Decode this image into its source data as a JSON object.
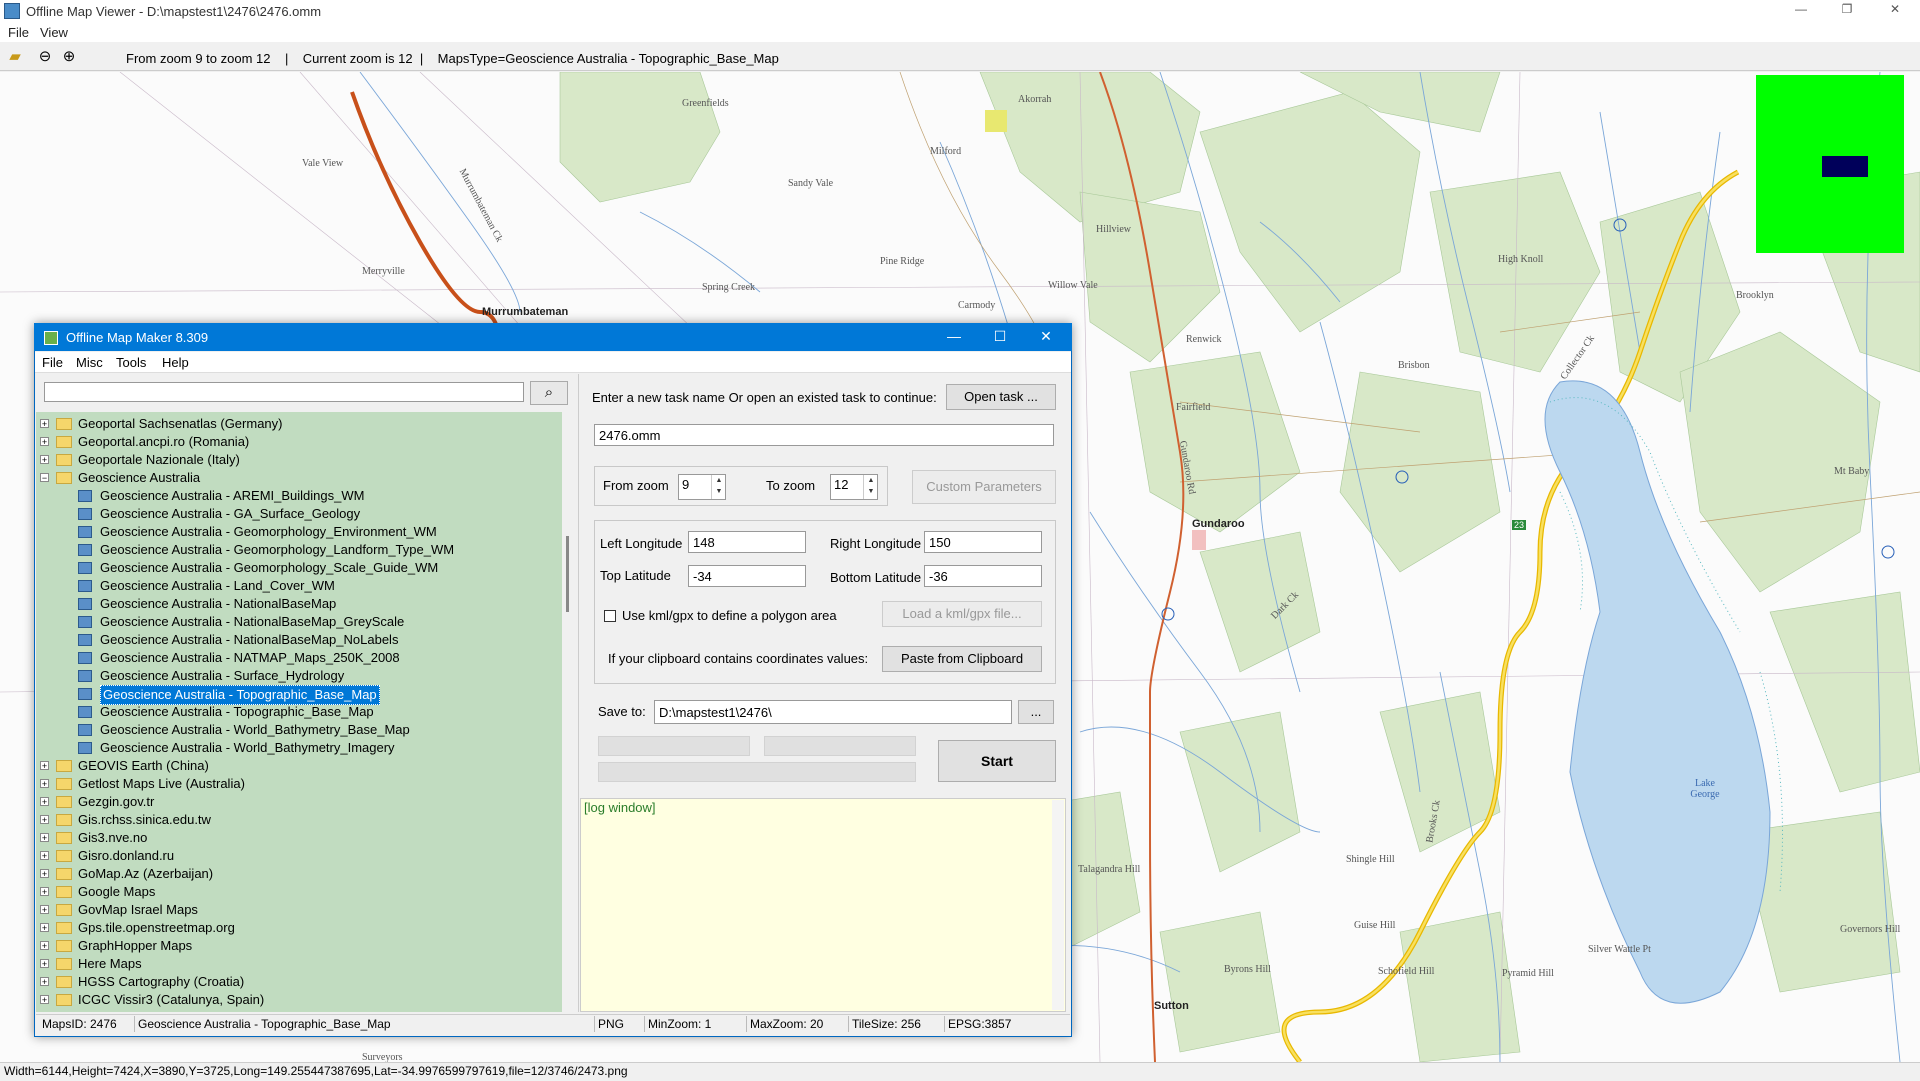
{
  "viewer": {
    "title": "Offline Map Viewer - D:\\mapstest1\\2476\\2476.omm",
    "menu": [
      "File",
      "View"
    ],
    "toolbar_status": "From zoom 9 to zoom 12    |    Current zoom is 12  |    MapsType=Geoscience Australia - Topographic_Base_Map",
    "bottom_status": "Width=6144,Height=7424,X=3890,Y=3725,Long=149.255447387695,Lat=-34.9976599797619,file=12/3746/2473.png",
    "icons": [
      "folder-open-icon",
      "zoom-out-icon",
      "zoom-in-icon"
    ],
    "window_controls": [
      "—",
      "❐",
      "✕"
    ]
  },
  "map": {
    "towns": [
      "Murrumbateman",
      "Gundaroo",
      "Sutton"
    ],
    "places": [
      "Greenfields",
      "Akorrah",
      "Milford",
      "Vale View",
      "Sandy Vale",
      "Merryville",
      "Pine Ridge",
      "Spring Creek",
      "Carmody",
      "Willow Vale",
      "Hillview",
      "High Knoll",
      "Brooklyn",
      "Renwick",
      "Brisbon",
      "Fairfield",
      "Mt Baby",
      "Talagandra Hill",
      "Shingle Hill",
      "Guise Hill",
      "Byrons Hill",
      "Schofield Hill",
      "Pyramid Hill",
      "Silver Wattle Pt",
      "Governors Hill",
      "Surveyors"
    ],
    "watercourses": [
      "Murrumbateman Ck",
      "Collector Ck",
      "Dark Ck",
      "Brooks Ck",
      "Gundaroo Rd"
    ],
    "lake": "Lake George",
    "route": "23"
  },
  "dialog": {
    "title": "Offline Map Maker 8.309",
    "menu": [
      "File",
      "Misc",
      "Tools",
      "Help"
    ],
    "search_placeholder": "",
    "tree": [
      {
        "label": "Geoportal Sachsenatlas (Germany)",
        "level": 0,
        "type": "folder",
        "exp": "+"
      },
      {
        "label": "Geoportal.ancpi.ro (Romania)",
        "level": 0,
        "type": "folder",
        "exp": "+"
      },
      {
        "label": "Geoportale Nazionale (Italy)",
        "level": 0,
        "type": "folder",
        "exp": "+"
      },
      {
        "label": "Geoscience Australia",
        "level": 0,
        "type": "folder",
        "exp": "−"
      },
      {
        "label": "Geoscience Australia - AREMI_Buildings_WM",
        "level": 1,
        "type": "map"
      },
      {
        "label": "Geoscience Australia - GA_Surface_Geology",
        "level": 1,
        "type": "map"
      },
      {
        "label": "Geoscience Australia - Geomorphology_Environment_WM",
        "level": 1,
        "type": "map"
      },
      {
        "label": "Geoscience Australia - Geomorphology_Landform_Type_WM",
        "level": 1,
        "type": "map"
      },
      {
        "label": "Geoscience Australia - Geomorphology_Scale_Guide_WM",
        "level": 1,
        "type": "map"
      },
      {
        "label": "Geoscience Australia - Land_Cover_WM",
        "level": 1,
        "type": "map"
      },
      {
        "label": "Geoscience Australia - NationalBaseMap",
        "level": 1,
        "type": "map"
      },
      {
        "label": "Geoscience Australia - NationalBaseMap_GreyScale",
        "level": 1,
        "type": "map"
      },
      {
        "label": "Geoscience Australia - NationalBaseMap_NoLabels",
        "level": 1,
        "type": "map"
      },
      {
        "label": "Geoscience Australia - NATMAP_Maps_250K_2008",
        "level": 1,
        "type": "map"
      },
      {
        "label": "Geoscience Australia - Surface_Hydrology",
        "level": 1,
        "type": "map"
      },
      {
        "label": "Geoscience Australia - Topographic_Base_Map",
        "level": 1,
        "type": "map",
        "selected": true
      },
      {
        "label": "Geoscience Australia - Topographic_Base_Map",
        "level": 1,
        "type": "map"
      },
      {
        "label": "Geoscience Australia - World_Bathymetry_Base_Map",
        "level": 1,
        "type": "map"
      },
      {
        "label": "Geoscience Australia - World_Bathymetry_Imagery",
        "level": 1,
        "type": "map"
      },
      {
        "label": "GEOVIS Earth (China)",
        "level": 0,
        "type": "folder",
        "exp": "+"
      },
      {
        "label": "Getlost Maps Live (Australia)",
        "level": 0,
        "type": "folder",
        "exp": "+"
      },
      {
        "label": "Gezgin.gov.tr",
        "level": 0,
        "type": "folder",
        "exp": "+"
      },
      {
        "label": "Gis.rchss.sinica.edu.tw",
        "level": 0,
        "type": "folder",
        "exp": "+"
      },
      {
        "label": "Gis3.nve.no",
        "level": 0,
        "type": "folder",
        "exp": "+"
      },
      {
        "label": "Gisro.donland.ru",
        "level": 0,
        "type": "folder",
        "exp": "+"
      },
      {
        "label": "GoMap.Az (Azerbaijan)",
        "level": 0,
        "type": "folder",
        "exp": "+"
      },
      {
        "label": "Google Maps",
        "level": 0,
        "type": "folder",
        "exp": "+"
      },
      {
        "label": "GovMap Israel Maps",
        "level": 0,
        "type": "folder",
        "exp": "+"
      },
      {
        "label": "Gps.tile.openstreetmap.org",
        "level": 0,
        "type": "folder",
        "exp": "+"
      },
      {
        "label": "GraphHopper Maps",
        "level": 0,
        "type": "folder",
        "exp": "+"
      },
      {
        "label": "Here Maps",
        "level": 0,
        "type": "folder",
        "exp": "+"
      },
      {
        "label": "HGSS Cartography (Croatia)",
        "level": 0,
        "type": "folder",
        "exp": "+"
      },
      {
        "label": "ICGC Vissir3 (Catalunya, Spain)",
        "level": 0,
        "type": "folder",
        "exp": "+"
      }
    ],
    "task_prompt": "Enter a new task name Or open an existed task to continue:",
    "open_task_button": "Open task ...",
    "task_name": "2476.omm",
    "from_zoom_label": "From zoom",
    "from_zoom": "9",
    "to_zoom_label": "To zoom",
    "to_zoom": "12",
    "custom_params_button": "Custom Parameters",
    "left_lon_label": "Left Longitude",
    "left_lon": "148",
    "right_lon_label": "Right Longitude",
    "right_lon": "150",
    "top_lat_label": "Top Latitude",
    "top_lat": "-34",
    "bottom_lat_label": "Bottom Latitude",
    "bottom_lat": "-36",
    "kml_checkbox_label": "Use kml/gpx to define a polygon area",
    "load_kml_button": "Load a kml/gpx file...",
    "clipboard_label": "If your clipboard contains coordinates values:",
    "paste_button": "Paste from Clipboard",
    "save_to_label": "Save to:",
    "save_to": "D:\\mapstest1\\2476\\",
    "browse_button": "...",
    "start_button": "Start",
    "log_text": "[log window]",
    "status": {
      "maps_id": "MapsID: 2476",
      "maps_name": "Geoscience Australia - Topographic_Base_Map",
      "format": "PNG",
      "min_zoom": "MinZoom: 1",
      "max_zoom": "MaxZoom: 20",
      "tile_size": "TileSize: 256",
      "epsg": "EPSG:3857"
    },
    "window_controls": [
      "—",
      "☐",
      "✕"
    ]
  },
  "colors": {
    "titlebar": "#0078d7",
    "tree_bg": "#c1dcc0",
    "log_bg": "#ffffe1",
    "lake": "#bcd8ef",
    "vegetation": "#d8e8c8",
    "minimap_bg": "#00ff00",
    "minimap_view": "#00005a"
  }
}
